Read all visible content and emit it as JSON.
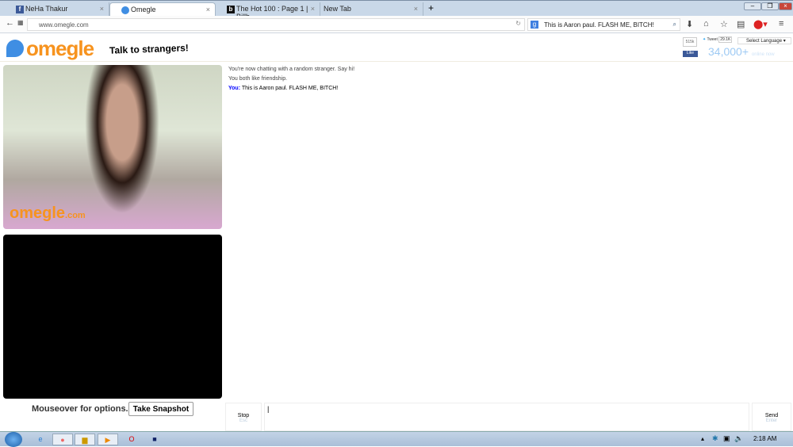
{
  "browser": {
    "tabs": [
      {
        "label": "NeHa Thakur",
        "icon": "facebook-icon",
        "active": false
      },
      {
        "label": "Omegle",
        "icon": "omegle-icon",
        "active": true
      },
      {
        "label": "The Hot 100 : Page 1 | Billb...",
        "icon": "billboard-icon",
        "active": false
      },
      {
        "label": "New Tab",
        "icon": "",
        "active": false
      }
    ],
    "new_tab": "+",
    "url": "www.omegle.com",
    "search_value": "This is Aaron paul. FLASH ME, BITCH!"
  },
  "omegle": {
    "logo": "omegle",
    "tagline": "Talk to strangers!",
    "fb_count": "515k",
    "fb_like": "Like",
    "tweet": "Tweet",
    "tweet_count": "29.1K",
    "language": "Select Language",
    "online_count": "34,000+",
    "online_label": "online now",
    "watermark": "omegle",
    "watermark_suffix": ".com",
    "mouseover": "Mouseover for options.",
    "snapshot": "Take Snapshot",
    "messages": [
      {
        "text": "You're now chatting with a random stranger. Say hi!"
      },
      {
        "text": "You both like friendship."
      }
    ],
    "you_label": "You:",
    "you_message": "This is Aaron paul. FLASH ME, BITCH!",
    "stop": "Stop",
    "stop_hint": "Esc",
    "send": "Send",
    "send_hint": "Enter"
  },
  "taskbar": {
    "clock": "2:18 AM"
  }
}
